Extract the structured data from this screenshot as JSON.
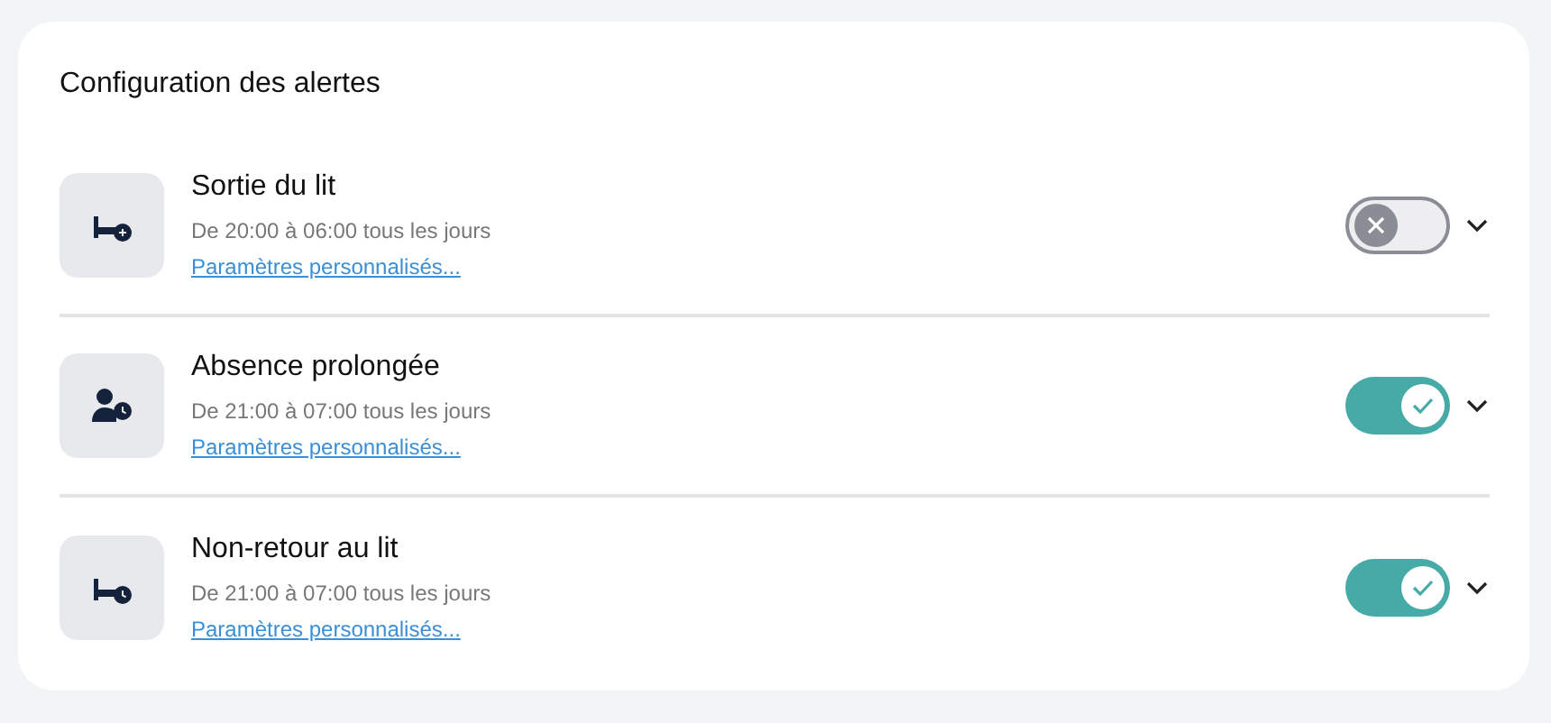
{
  "title": "Configuration des alertes",
  "alerts": [
    {
      "kind": "bed-exit",
      "name": "Sortie du lit",
      "schedule": "De 20:00 à 06:00 tous les jours",
      "link": "Paramètres personnalisés...",
      "on": false
    },
    {
      "kind": "person-clock",
      "name": "Absence prolongée",
      "schedule": "De 21:00 à 07:00 tous les jours",
      "link": "Paramètres personnalisés...",
      "on": true
    },
    {
      "kind": "bed-clock",
      "name": "Non-retour au lit",
      "schedule": "De 21:00 à 07:00 tous les jours",
      "link": "Paramètres personnalisés...",
      "on": true
    }
  ]
}
